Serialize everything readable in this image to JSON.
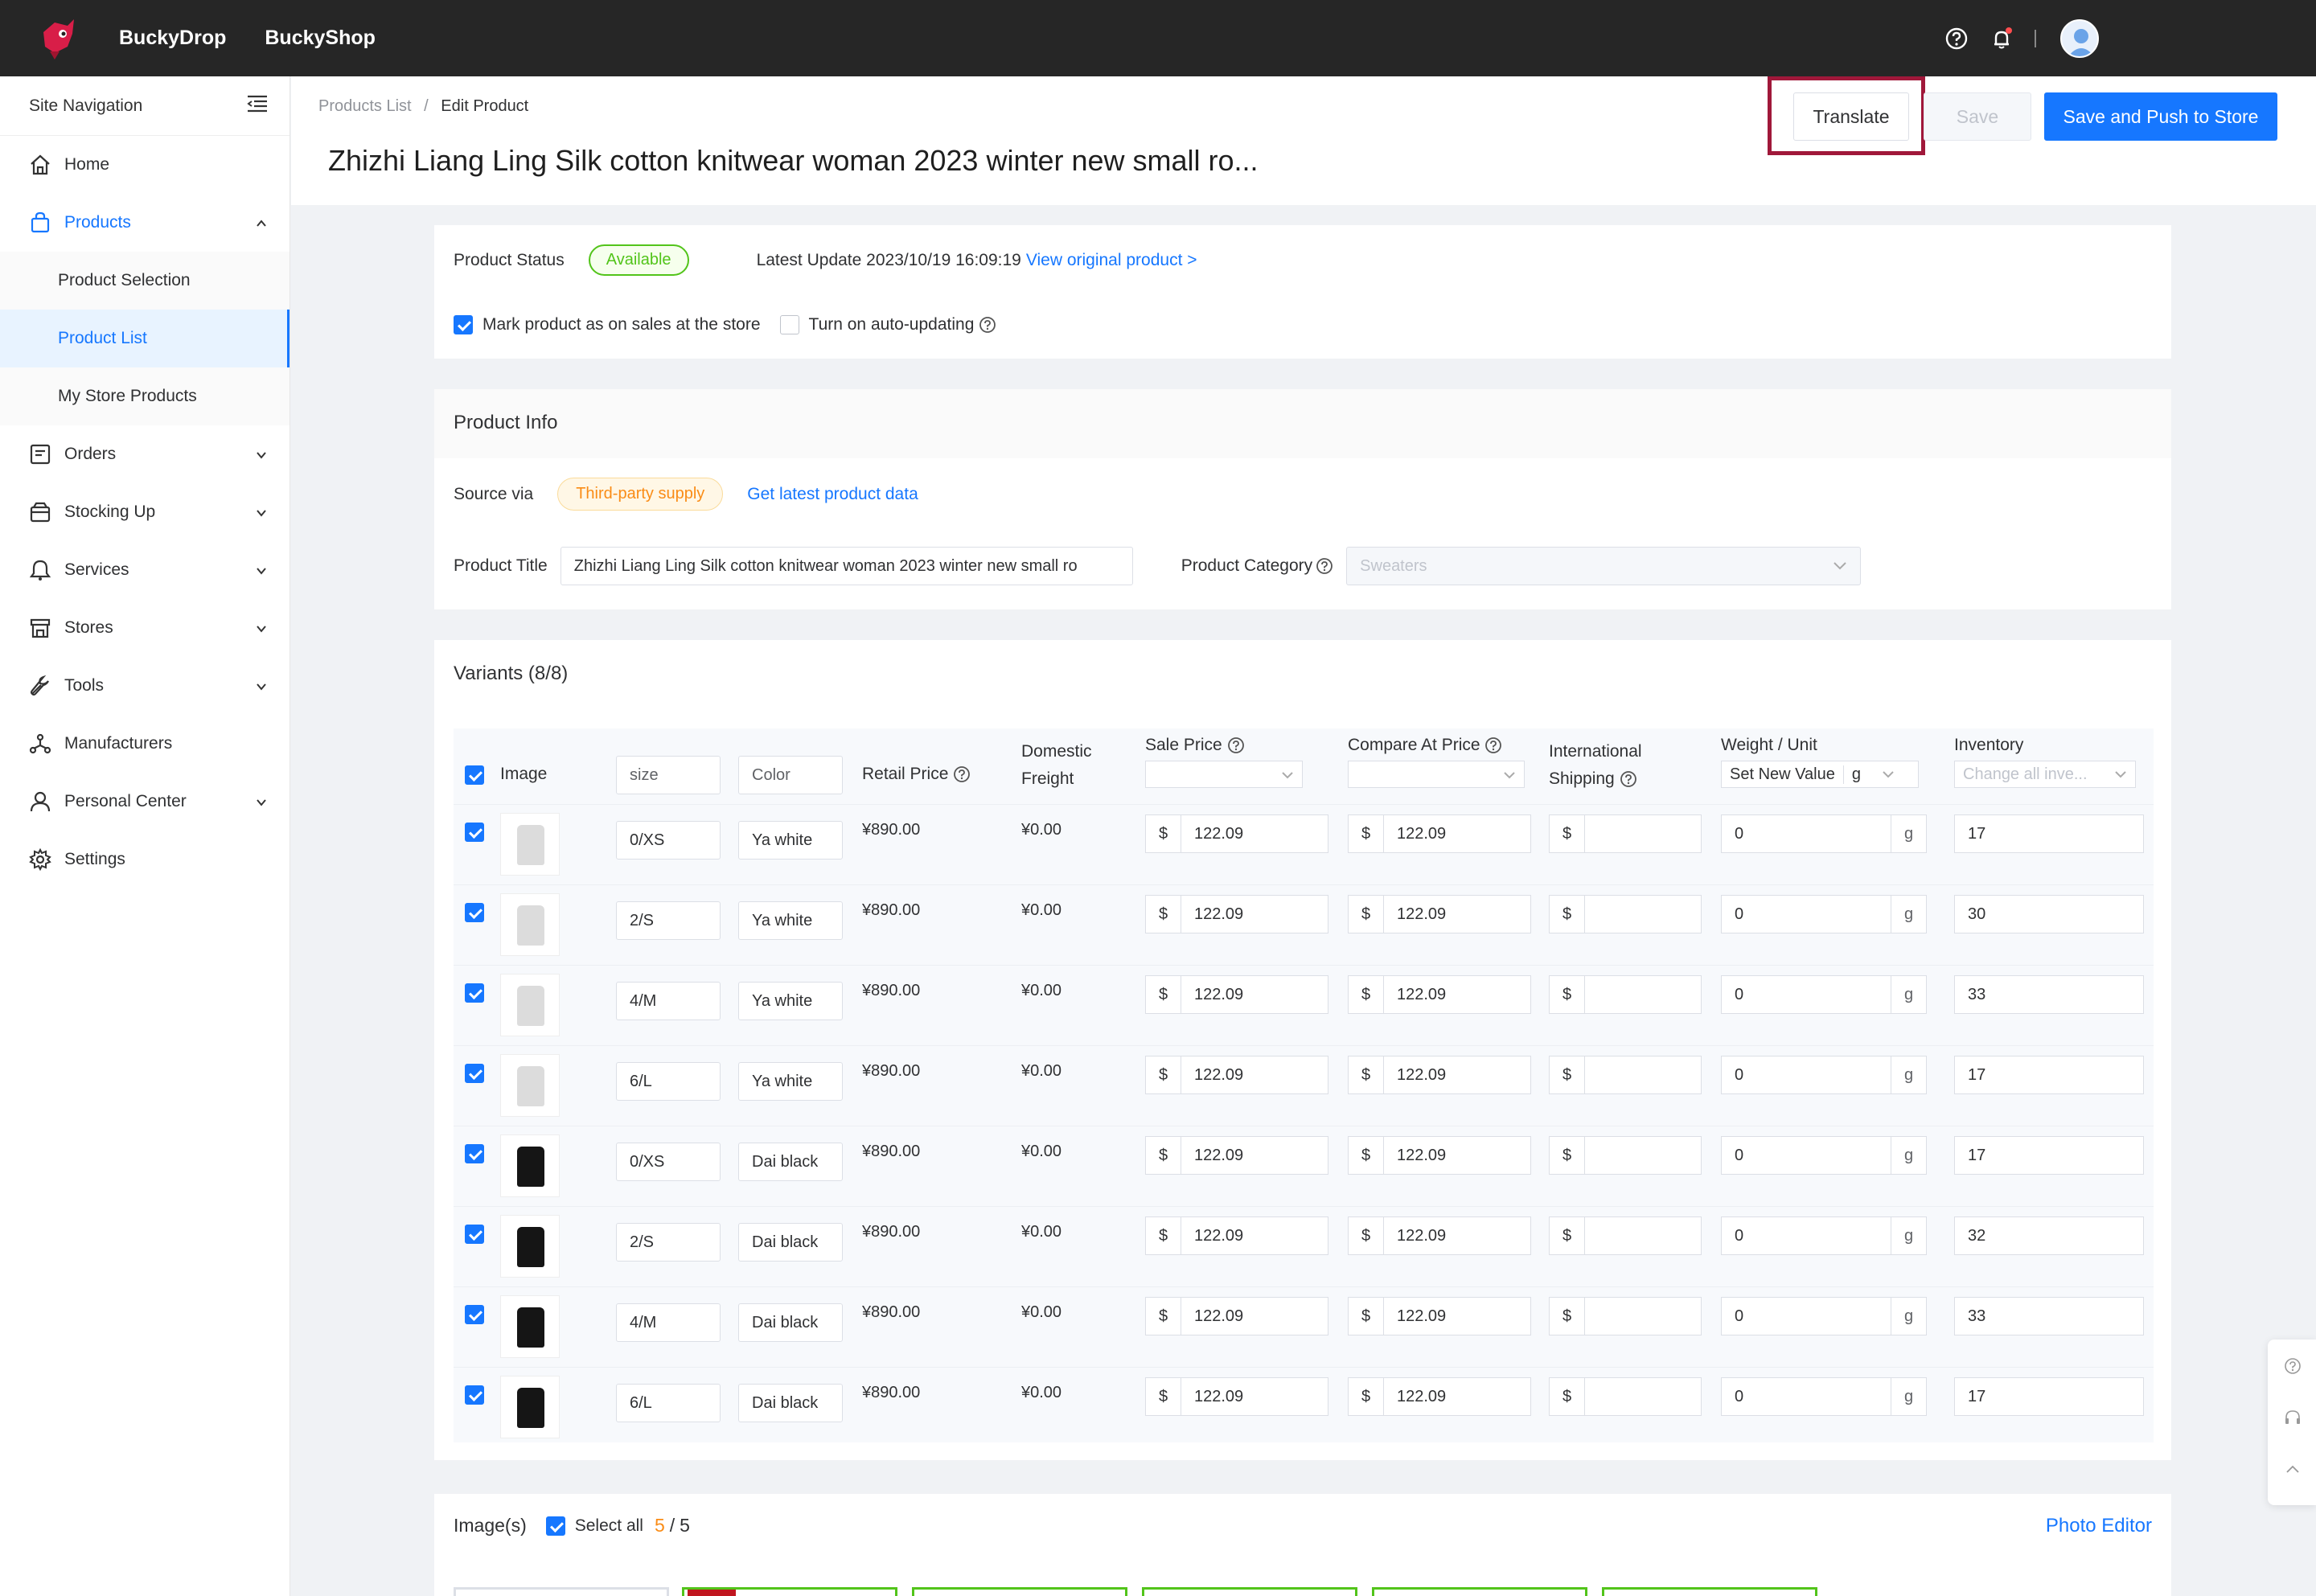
{
  "topbar": {
    "brand1": "BuckyDrop",
    "brand2": "BuckyShop",
    "icons": [
      "help-icon",
      "bell-icon",
      "avatar"
    ]
  },
  "sidebar": {
    "header": "Site Navigation",
    "items": [
      {
        "label": "Home",
        "icon": "home-icon"
      },
      {
        "label": "Products",
        "icon": "shopping-bag-icon",
        "expanded": true
      },
      {
        "label": "Orders",
        "icon": "orders-icon"
      },
      {
        "label": "Stocking Up",
        "icon": "box-icon"
      },
      {
        "label": "Services",
        "icon": "services-icon"
      },
      {
        "label": "Stores",
        "icon": "store-icon"
      },
      {
        "label": "Tools",
        "icon": "wrench-icon"
      },
      {
        "label": "Manufacturers",
        "icon": "network-icon"
      },
      {
        "label": "Personal Center",
        "icon": "user-icon"
      },
      {
        "label": "Settings",
        "icon": "gear-icon"
      }
    ],
    "sub_items": [
      "Product Selection",
      "Product List",
      "My Store Products"
    ]
  },
  "header": {
    "breadcrumb_root": "Products List",
    "breadcrumb_sep": "/",
    "breadcrumb_current": "Edit Product",
    "title": "Zhizhi Liang Ling Silk cotton knitwear woman 2023 winter new small ro...",
    "translate": "Translate",
    "save": "Save",
    "push": "Save and Push to Store"
  },
  "status": {
    "label": "Product Status",
    "value": "Available",
    "update_label": "Latest Update 2023/10/19 16:09:19",
    "view_original": "View original product >",
    "mark_on_sale": "Mark product as on sales at the store",
    "auto_update": "Turn on auto-updating"
  },
  "info": {
    "title": "Product Info",
    "source_label": "Source via",
    "source_value": "Third-party supply",
    "get_latest": "Get latest product data",
    "title_label": "Product Title",
    "title_value": "Zhizhi Liang Ling Silk cotton knitwear woman 2023 winter new small ro",
    "category_label": "Product Category",
    "category_value": "Sweaters"
  },
  "variants": {
    "title": "Variants (8/8)",
    "headers": {
      "image": "Image",
      "size": "size",
      "color": "Color",
      "retail": "Retail Price",
      "domestic1": "Domestic",
      "domestic2": "Freight",
      "sale": "Sale Price",
      "compare": "Compare At Price",
      "intl1": "International",
      "intl2": "Shipping",
      "weight": "Weight / Unit",
      "weight_set": "Set New Value",
      "weight_unit": "g",
      "inventory": "Inventory",
      "inventory_ph": "Change all inve..."
    },
    "currency": "$",
    "unit": "g",
    "rows": [
      {
        "size": "0/XS",
        "color": "Ya white",
        "retail": "¥890.00",
        "freight": "¥0.00",
        "sale": "122.09",
        "compare": "122.09",
        "weight": "0",
        "inventory": "17",
        "shade": "light"
      },
      {
        "size": "2/S",
        "color": "Ya white",
        "retail": "¥890.00",
        "freight": "¥0.00",
        "sale": "122.09",
        "compare": "122.09",
        "weight": "0",
        "inventory": "30",
        "shade": "light"
      },
      {
        "size": "4/M",
        "color": "Ya white",
        "retail": "¥890.00",
        "freight": "¥0.00",
        "sale": "122.09",
        "compare": "122.09",
        "weight": "0",
        "inventory": "33",
        "shade": "light"
      },
      {
        "size": "6/L",
        "color": "Ya white",
        "retail": "¥890.00",
        "freight": "¥0.00",
        "sale": "122.09",
        "compare": "122.09",
        "weight": "0",
        "inventory": "17",
        "shade": "light"
      },
      {
        "size": "0/XS",
        "color": "Dai black",
        "retail": "¥890.00",
        "freight": "¥0.00",
        "sale": "122.09",
        "compare": "122.09",
        "weight": "0",
        "inventory": "17",
        "shade": "dark"
      },
      {
        "size": "2/S",
        "color": "Dai black",
        "retail": "¥890.00",
        "freight": "¥0.00",
        "sale": "122.09",
        "compare": "122.09",
        "weight": "0",
        "inventory": "32",
        "shade": "dark"
      },
      {
        "size": "4/M",
        "color": "Dai black",
        "retail": "¥890.00",
        "freight": "¥0.00",
        "sale": "122.09",
        "compare": "122.09",
        "weight": "0",
        "inventory": "33",
        "shade": "dark"
      },
      {
        "size": "6/L",
        "color": "Dai black",
        "retail": "¥890.00",
        "freight": "¥0.00",
        "sale": "122.09",
        "compare": "122.09",
        "weight": "0",
        "inventory": "17",
        "shade": "dark"
      }
    ]
  },
  "images": {
    "title": "Image(s)",
    "select_all": "Select all",
    "count_selected": "5",
    "count_sep": "/",
    "count_total": "5",
    "editor": "Photo Editor"
  },
  "colors": {
    "accent": "#1677ff",
    "success": "#52c41a",
    "warning": "#fa8c16",
    "highlight": "#a0183a"
  }
}
